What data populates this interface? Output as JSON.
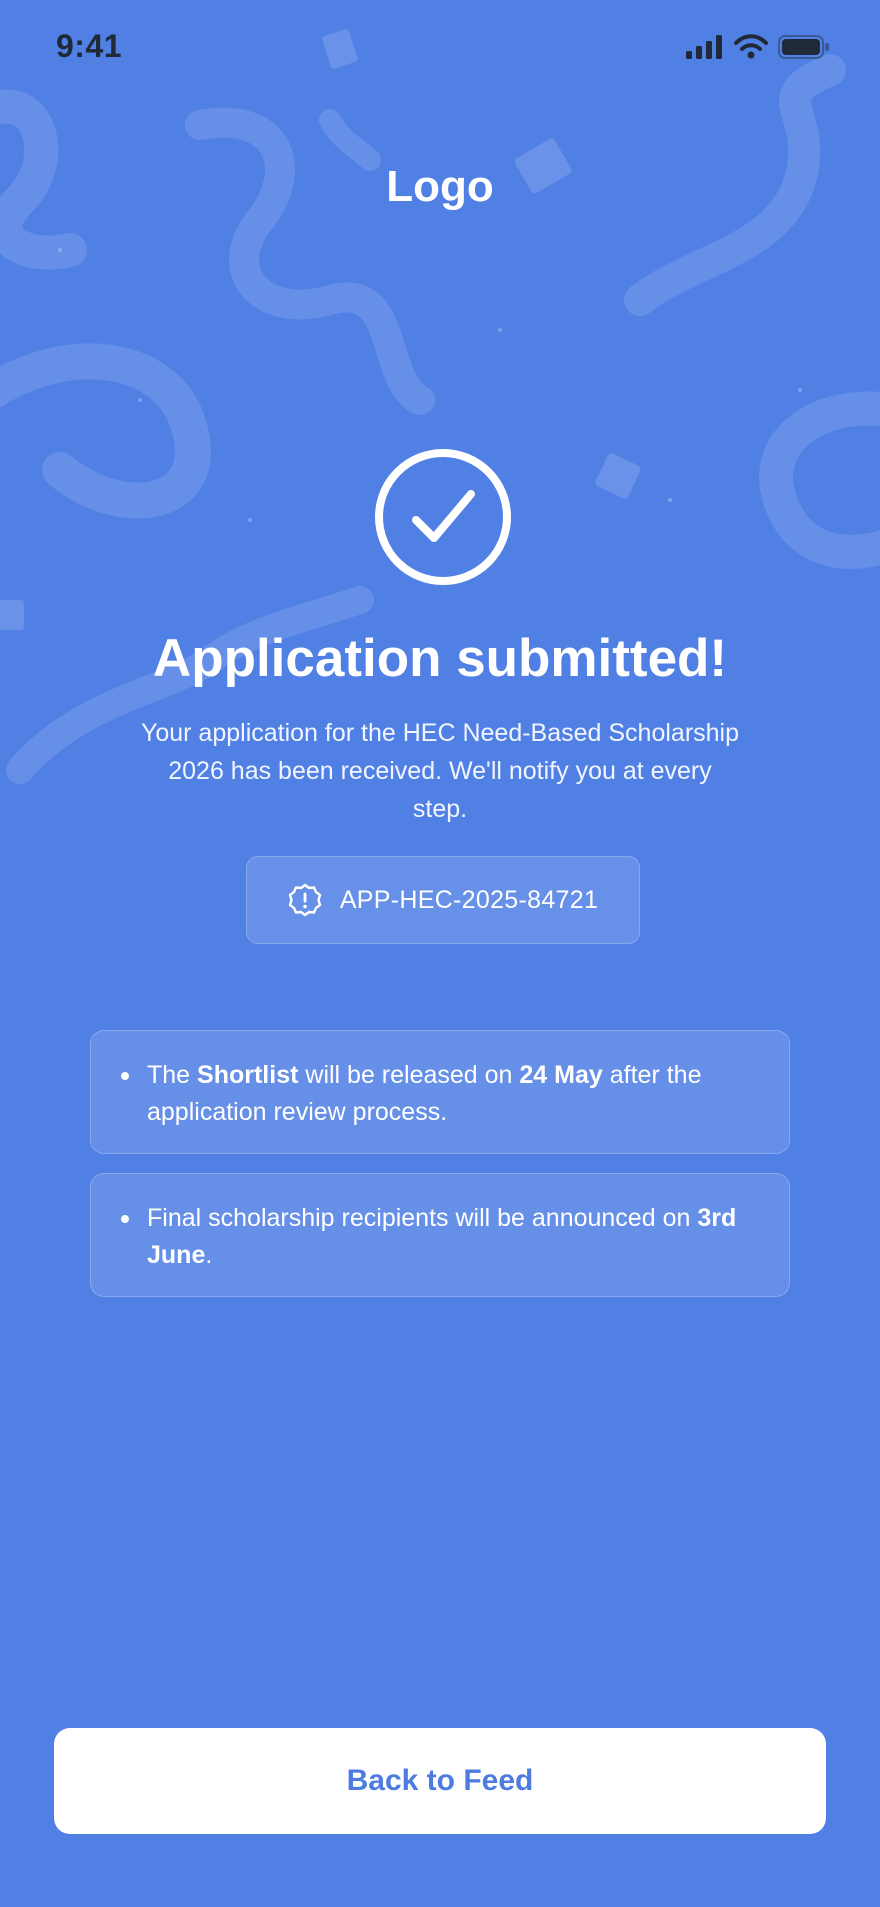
{
  "status_bar": {
    "time": "9:41",
    "icons": [
      "signal-icon",
      "wifi-icon",
      "battery-icon"
    ]
  },
  "header": {
    "logo": "Logo"
  },
  "confirmation": {
    "icon": "check-circle-icon",
    "title": "Application submitted!",
    "message": "Your application for the HEC Need-Based Scholarship 2026 has been received. We'll notify you at every step."
  },
  "application_id": {
    "icon": "info-badge-icon",
    "value": "APP-HEC-2025-84721"
  },
  "info_cards": [
    {
      "parts": [
        {
          "text": "The ",
          "bold": false
        },
        {
          "text": "Shortlist",
          "bold": true
        },
        {
          "text": " will be released on ",
          "bold": false
        },
        {
          "text": "24 May",
          "bold": true
        },
        {
          "text": " after the application review process.",
          "bold": false
        }
      ]
    },
    {
      "parts": [
        {
          "text": "Final scholarship recipients will be announced on ",
          "bold": false
        },
        {
          "text": "3rd June",
          "bold": true
        },
        {
          "text": ".",
          "bold": false
        }
      ]
    }
  ],
  "footer": {
    "back_button_label": "Back to Feed"
  },
  "colors": {
    "background": "#5180e5",
    "button_text": "#4e7be0",
    "white": "#ffffff"
  }
}
